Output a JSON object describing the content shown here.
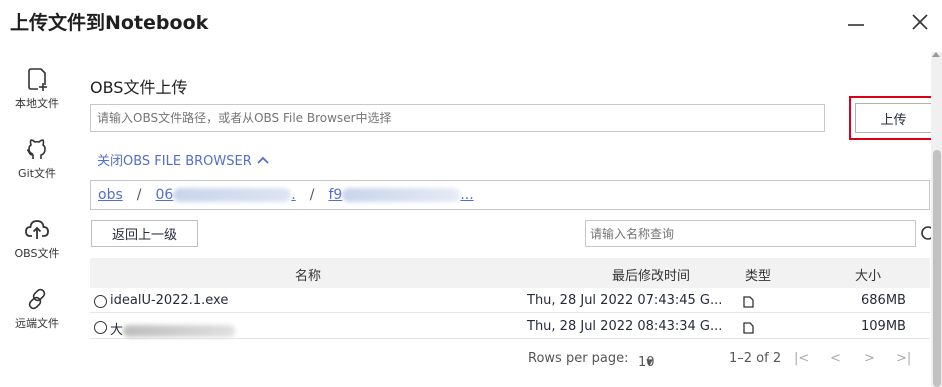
{
  "dialog": {
    "title": "上传文件到Notebook"
  },
  "sidebar": {
    "items": [
      {
        "label": "本地文件",
        "icon": "local-file-icon"
      },
      {
        "label": "Git文件",
        "icon": "github-icon"
      },
      {
        "label": "OBS文件",
        "icon": "cloud-upload-icon"
      },
      {
        "label": "远端文件",
        "icon": "link-icon"
      }
    ]
  },
  "panel": {
    "title": "OBS文件上传",
    "path_placeholder": "请输入OBS文件路径，或者从OBS File Browser中选择",
    "upload_label": "上传",
    "toggle_label": "关闭OBS FILE BROWSER"
  },
  "breadcrumb": {
    "root": "obs",
    "seg1_prefix": "06",
    "seg1_suffix": ".",
    "seg2_prefix": "f9",
    "seg2_suffix": "..."
  },
  "browser": {
    "back_label": "返回上一级",
    "search_placeholder": "请输入名称查询"
  },
  "table": {
    "headers": {
      "name": "名称",
      "modified": "最后修改时间",
      "type": "类型",
      "size": "大小"
    },
    "rows": [
      {
        "name": "idealU-2022.1.exe",
        "modified": "Thu, 28 Jul 2022 07:43:45 G...",
        "size": "686MB"
      },
      {
        "name": "大",
        "modified": "Thu, 28 Jul 2022 08:43:34 G...",
        "size": "109MB"
      }
    ]
  },
  "pagination": {
    "rows_label": "Rows per page:",
    "rows_value": "10",
    "range": "1–2 of 2"
  },
  "colors": {
    "link": "#526ecc",
    "highlight": "#d9001b"
  }
}
